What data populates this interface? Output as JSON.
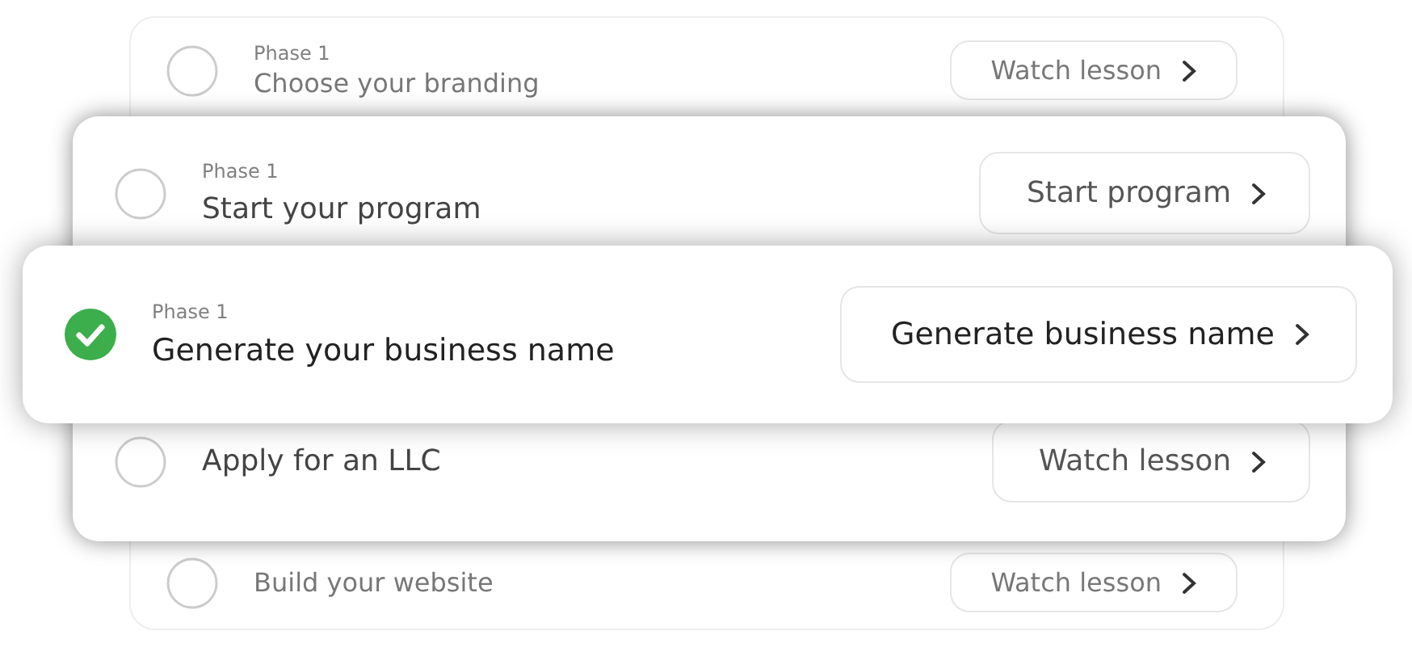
{
  "layers": [
    {
      "rows": [
        {
          "phase": "Phase 1",
          "title": "Choose your branding",
          "action": "Watch lesson",
          "checked": false
        },
        {
          "title": "Build your website",
          "action": "Watch lesson",
          "checked": false
        }
      ]
    },
    {
      "rows": [
        {
          "phase": "Phase 1",
          "title": "Start your program",
          "action": "Start program",
          "checked": false
        },
        {
          "title": "Apply for an LLC",
          "action": "Watch lesson",
          "checked": false
        }
      ]
    },
    {
      "rows": [
        {
          "phase": "Phase 1",
          "title": "Generate your business name",
          "action": "Generate business name",
          "checked": true
        }
      ]
    }
  ]
}
